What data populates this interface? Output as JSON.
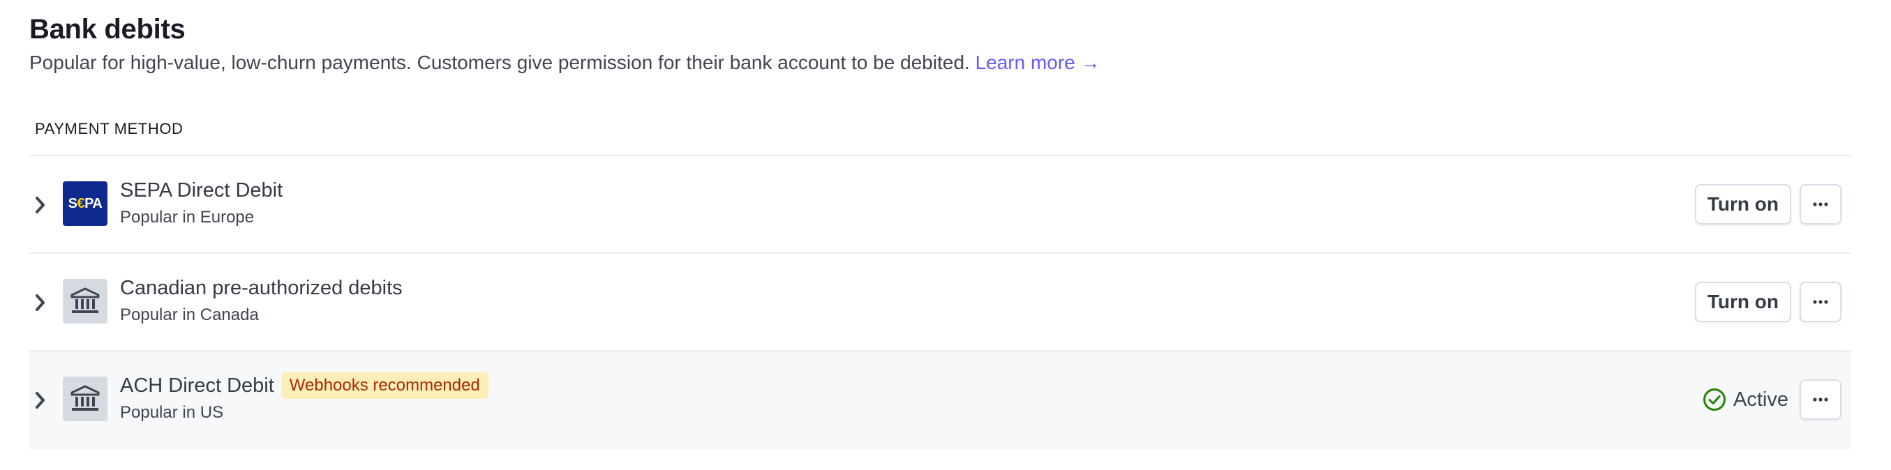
{
  "section": {
    "title": "Bank debits",
    "description": "Popular for high-value, low-churn payments. Customers give permission for their bank account to be debited.",
    "learn_more": "Learn more",
    "learn_more_arrow": "→"
  },
  "table": {
    "header": "PAYMENT METHOD",
    "rows": [
      {
        "name": "SEPA Direct Debit",
        "subtitle": "Popular in Europe",
        "icon": "sepa-logo",
        "icon_text_1": "S",
        "icon_text_2": "€",
        "icon_text_3": "PA",
        "action_label": "Turn on",
        "more_label": "···"
      },
      {
        "name": "Canadian pre-authorized debits",
        "subtitle": "Popular in Canada",
        "icon": "bank-icon",
        "action_label": "Turn on",
        "more_label": "···"
      },
      {
        "name": "ACH Direct Debit",
        "badge": "Webhooks recommended",
        "subtitle": "Popular in US",
        "icon": "bank-icon",
        "status": "Active",
        "more_label": "···"
      }
    ]
  },
  "colors": {
    "accent": "#635bff",
    "sepa_bg": "#10298e",
    "badge_bg": "#fcedb9",
    "badge_text": "#a82c00",
    "active_green": "#228403"
  }
}
